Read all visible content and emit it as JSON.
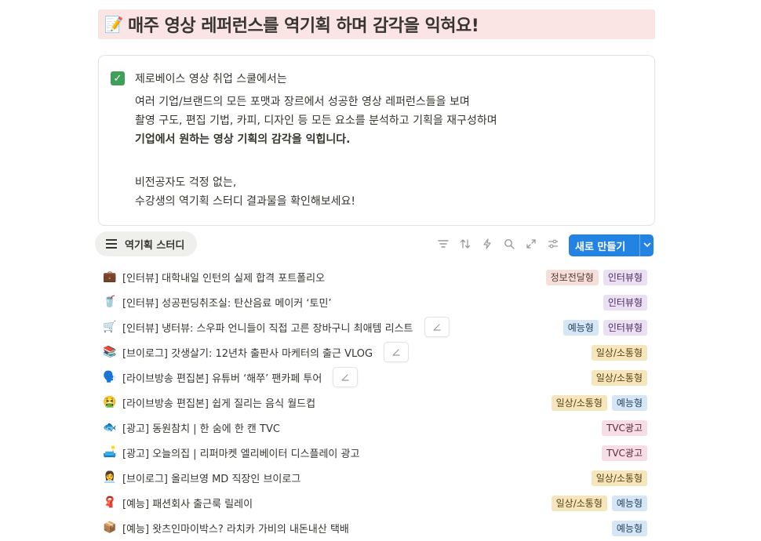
{
  "heading": {
    "emoji": "📝",
    "title": "매주 영상 레퍼런스를 역기획 하며 감각을 익혀요!"
  },
  "callout": {
    "check": "✓",
    "lines": [
      "제로베이스 영상 취업 스쿨에서는",
      "여러 기업/브랜드의 모든 포맷과 장르에서 성공한 영상 레퍼런스들을 보며",
      "촬영 구도, 편집 기법, 카피, 디자인 등 모든 요소를 분석하고 기획을 재구성하며",
      "기업에서 원하는 영상 기획의 감각을 익힙니다.",
      "비전공자도 걱정 없는,",
      "수강생의 역기획 스터디 결과물을 확인해보세요!"
    ]
  },
  "toolbar": {
    "view_tab": "역기획 스터디",
    "icons": [
      "filter-icon",
      "sort-icon",
      "lightning-icon",
      "search-icon",
      "expand-icon",
      "settings-icon"
    ],
    "new_button": "새로 만들기",
    "dropdown_glyph": "⌄"
  },
  "rows": [
    {
      "emoji": "💼",
      "title": "[인터뷰] 대학내일 인턴의 실제 합격 포트폴리오",
      "edit": false,
      "tags": [
        "정보전달형",
        "인터뷰형"
      ]
    },
    {
      "emoji": "🥤",
      "title": "[인터뷰] 성공펀딩취조실: 탄산음료 메이커 ‘토민’",
      "edit": false,
      "tags": [
        "인터뷰형"
      ]
    },
    {
      "emoji": "🛒",
      "title": "[인터뷰] 냉터뷰: 스우파 언니들이 직접 고른 장바구니 최애템 리스트",
      "edit": true,
      "tags": [
        "예능형",
        "인터뷰형"
      ]
    },
    {
      "emoji": "📚",
      "title": "[브이로그] 갓생살기: 12년차 출판사 마케터의 출근 VLOG",
      "edit": true,
      "tags": [
        "일상/소통형"
      ]
    },
    {
      "emoji": "🗣️",
      "title": "[라이브방송 편집본] 유튜버 ‘해쭈’ 팬카페 투어",
      "edit": true,
      "tags": [
        "일상/소통형"
      ]
    },
    {
      "emoji": "🤮",
      "title": "[라이브방송 편집본] 쉽게 질리는 음식 월드컵",
      "edit": false,
      "tags": [
        "일상/소통형",
        "예능형"
      ]
    },
    {
      "emoji": "🐟",
      "title": "[광고] 동원참치 | 한 숨에 한 캔 TVC",
      "edit": false,
      "tags": [
        "TVC광고"
      ]
    },
    {
      "emoji": "🛋️",
      "title": "[광고] 오늘의집 | 리퍼마켓 엘리베이터 디스플레이 광고",
      "edit": false,
      "tags": [
        "TVC광고"
      ]
    },
    {
      "emoji": "👩‍💼",
      "title": "[브이로그] 올리브영 MD 직장인 브이로그",
      "edit": false,
      "tags": [
        "일상/소통형"
      ]
    },
    {
      "emoji": "🧣",
      "title": "[예능] 패션회사 출근룩 릴레이",
      "edit": false,
      "tags": [
        "일상/소통형",
        "예능형"
      ]
    },
    {
      "emoji": "📦",
      "title": "[예능] 왓츠인마이박스? 라치카 가비의 내돈내산 택배",
      "edit": false,
      "tags": [
        "예능형"
      ]
    }
  ],
  "tag_colors": {
    "정보전달형": {
      "bg": "#f4dfdb",
      "fg": "#5d3a34"
    },
    "인터뷰형": {
      "bg": "#ebdff4",
      "fg": "#4a2c5e"
    },
    "예능형": {
      "bg": "#d6e6f4",
      "fg": "#1f3f5e"
    },
    "일상/소통형": {
      "bg": "#f6e6bd",
      "fg": "#5c4411"
    },
    "TVC광고": {
      "bg": "#f6dde6",
      "fg": "#5e2a3c"
    }
  }
}
